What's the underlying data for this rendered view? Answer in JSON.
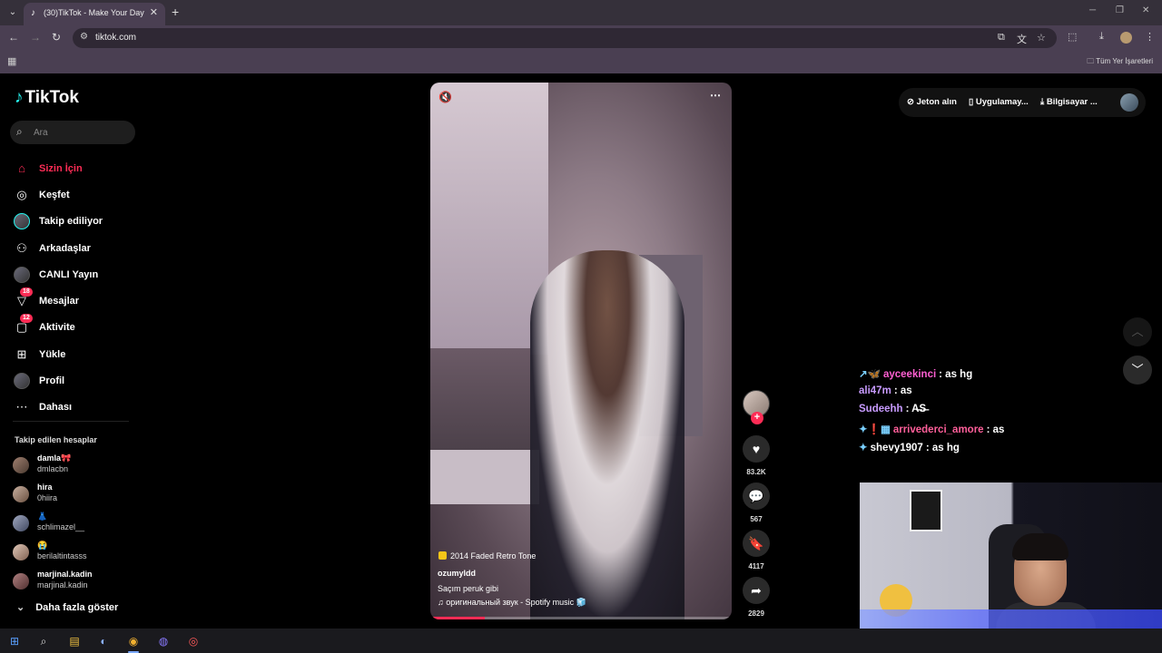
{
  "browser": {
    "tab_title": "(30)TikTok - Make Your Day",
    "tab_close": "✕",
    "new_tab": "+",
    "url": "tiktok.com",
    "bookmarks_all": "Tüm Yer İşaretleri"
  },
  "tiktok": {
    "logo_text": "TikTok",
    "search_placeholder": "Ara",
    "nav": [
      {
        "label": "Sizin İçin"
      },
      {
        "label": "Keşfet"
      },
      {
        "label": "Takip ediliyor"
      },
      {
        "label": "Arkadaşlar"
      },
      {
        "label": "CANLI Yayın"
      },
      {
        "label": "Mesajlar",
        "badge": "18"
      },
      {
        "label": "Aktivite",
        "badge": "12"
      },
      {
        "label": "Yükle"
      },
      {
        "label": "Profil"
      },
      {
        "label": "Dahası"
      }
    ],
    "following_header": "Takip edilen hesaplar",
    "following": [
      {
        "name": "damla🎀",
        "handle": "dmlacbn"
      },
      {
        "name": "hira",
        "handle": "0hiira"
      },
      {
        "name": "👗",
        "handle": "schlimazel__"
      },
      {
        "name": "😭",
        "handle": "berilaltintasss"
      },
      {
        "name": "marjinal.kadin",
        "handle": "marjinal.kadin"
      }
    ],
    "show_more": "Daha fazla göster",
    "video": {
      "effect": "2014 Faded Retro Tone",
      "username": "ozumyldd",
      "caption": "Saçım peruk gibi",
      "music": "♫ оригинальный звук - Spotify music 🧊",
      "progress": 0.18
    },
    "actions": {
      "likes": "83.2K",
      "comments": "567",
      "saves": "4117",
      "shares": "2829"
    },
    "topbar": {
      "coins": "Jeton alın",
      "app": "Uygulamay...",
      "pc": "Bilgisayar ..."
    }
  },
  "chat": [
    {
      "prefix": "↗🦋",
      "user": "ayceekinci",
      "user_color": "#ff5fd2",
      "msg": ": as hg"
    },
    {
      "prefix": "",
      "user": "ali47m",
      "user_color": "#c89bff",
      "msg": ": as"
    },
    {
      "prefix": "",
      "user": "Sudeehh",
      "user_color": "#c89bff",
      "msg": ": A̶S̶"
    },
    {
      "prefix": "✦❗▦",
      "user": "arrivederci_amore",
      "user_color": "#ff5f9a",
      "msg": ": as"
    },
    {
      "prefix": "✦",
      "user": "shevy1907",
      "user_color": "#ffffff",
      "msg": ": as hg"
    }
  ],
  "colors": {
    "accent": "#fe2c55",
    "chrome": "#4a3f52"
  }
}
